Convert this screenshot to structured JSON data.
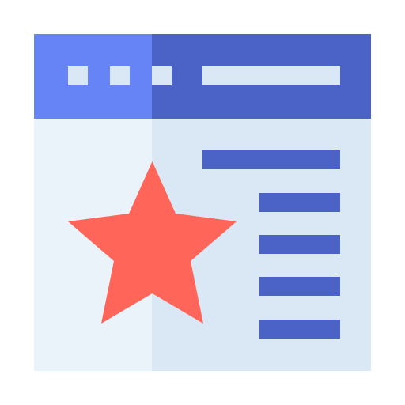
{
  "icon": {
    "name": "favorite-webpage-icon",
    "colors": {
      "titlebar_left": "#6784F7",
      "titlebar_right": "#4B63C7",
      "body_left": "#EBF3FA",
      "body_right": "#DAE7F5",
      "placeholder_light": "#DAE7F5",
      "content_lines": "#4B63C7",
      "star": "#FF6659"
    },
    "titlebar_dots": 3,
    "content_line_count": 5
  }
}
